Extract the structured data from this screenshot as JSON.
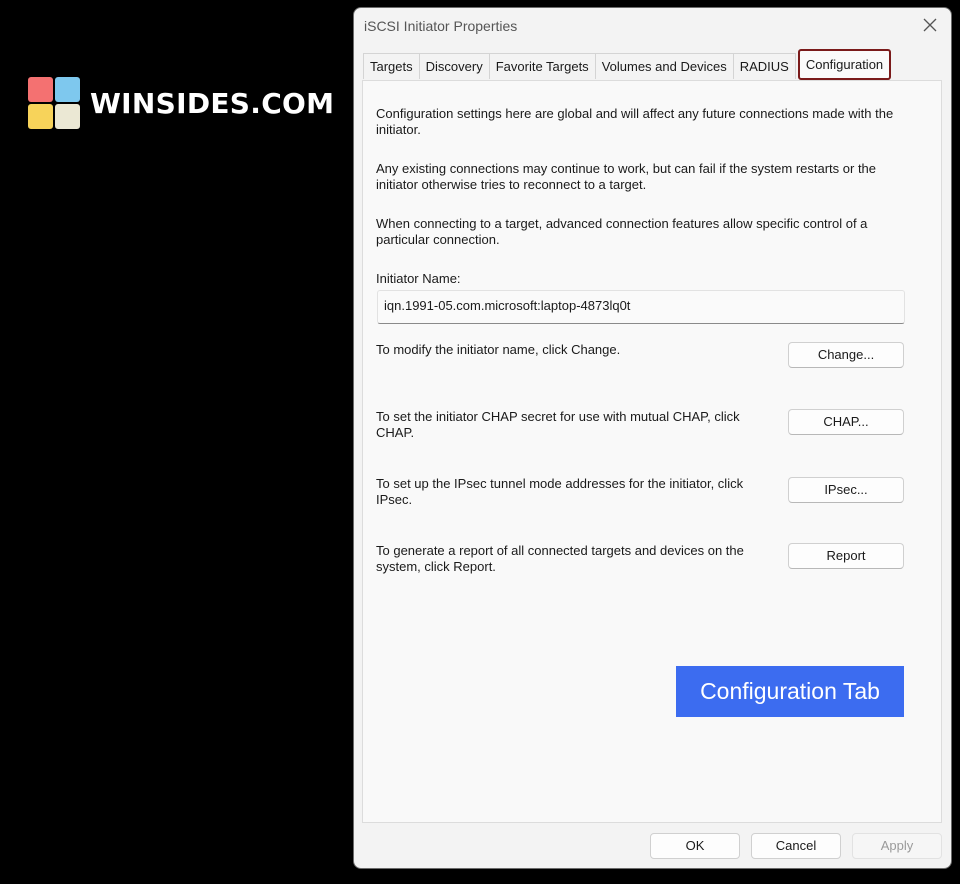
{
  "brand": {
    "text": "WINSIDES.COM",
    "tile_colors": [
      "#f47171",
      "#7ec8ee",
      "#f7d35a",
      "#ebe8d4"
    ]
  },
  "dialog": {
    "title": "iSCSI Initiator Properties",
    "close_icon": "close-icon"
  },
  "tabs": [
    {
      "label": "Targets"
    },
    {
      "label": "Discovery"
    },
    {
      "label": "Favorite Targets"
    },
    {
      "label": "Volumes and Devices"
    },
    {
      "label": "RADIUS"
    },
    {
      "label": "Configuration",
      "active": true
    }
  ],
  "config": {
    "intro1": "Configuration settings here are global and will affect any future connections made with the initiator.",
    "intro2": "Any existing connections may continue to work, but can fail if the system restarts or the initiator otherwise tries to reconnect to a target.",
    "intro3": "When connecting to a target, advanced connection features allow specific control of a particular connection.",
    "initiator_label": "Initiator Name:",
    "initiator_value": "iqn.1991-05.com.microsoft:laptop-4873lq0t",
    "change_text": "To modify the initiator name, click Change.",
    "change_button": "Change...",
    "chap_text": "To set the initiator CHAP secret for use with mutual CHAP, click CHAP.",
    "chap_button": "CHAP...",
    "ipsec_text": "To set up the IPsec tunnel mode addresses for the initiator, click IPsec.",
    "ipsec_button": "IPsec...",
    "report_text": "To generate a report of all connected targets and devices on the system, click Report.",
    "report_button": "Report"
  },
  "callout": "Configuration Tab",
  "footer": {
    "ok": "OK",
    "cancel": "Cancel",
    "apply": "Apply"
  },
  "colors": {
    "accent_tab_border": "#7a1a1a",
    "callout_bg": "#3c6cf0"
  }
}
